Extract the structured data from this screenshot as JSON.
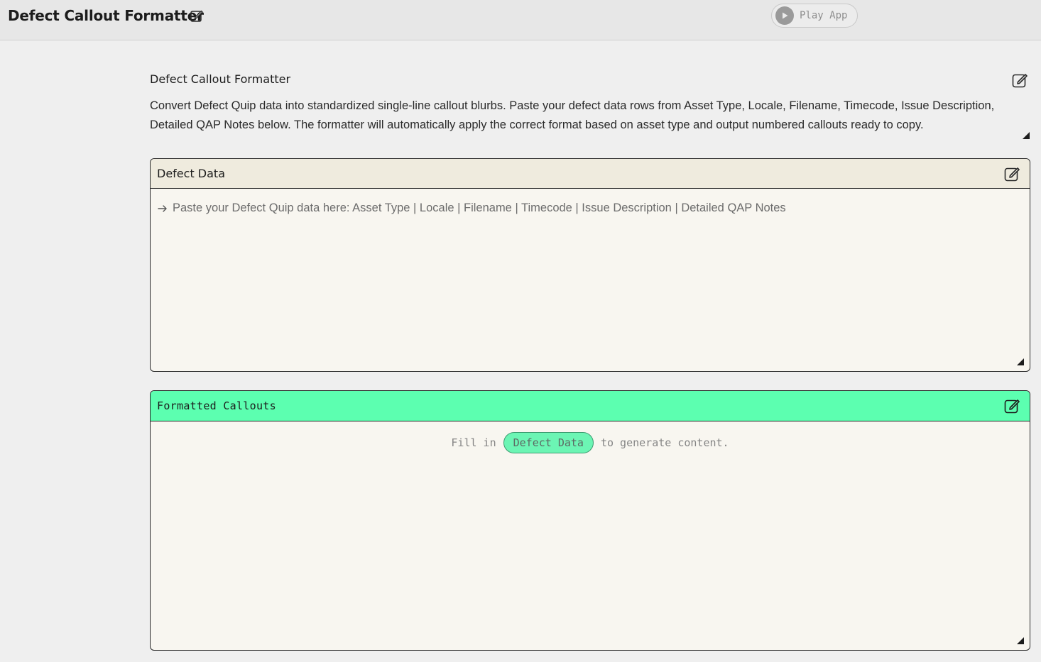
{
  "header": {
    "title": "Defect Callout Formatter",
    "play_label": "Play App"
  },
  "intro": {
    "title": "Defect Callout Formatter",
    "description": "Convert Defect Quip data into standardized single-line callout blurbs. Paste your defect data rows from Asset Type, Locale, Filename, Timecode, Issue Description, Detailed QAP Notes below. The formatter will automatically apply the correct format based on asset type and output numbered callouts ready to copy."
  },
  "defect_panel": {
    "label": "Defect Data",
    "placeholder": "Paste your Defect Quip data here: Asset Type | Locale | Filename | Timecode | Issue Description | Detailed QAP Notes"
  },
  "callout_panel": {
    "label": "Formatted Callouts",
    "prompt_prefix": "Fill in",
    "prompt_chip": "Defect Data",
    "prompt_suffix": "to generate content."
  },
  "icons": {
    "edit": "edit-square-icon",
    "play": "play-icon",
    "arrow": "arrow-right-icon",
    "resize": "resize-handle-icon"
  },
  "colors": {
    "accent_green": "#5cffb0",
    "panel_head_beige": "#efebde",
    "panel_body": "#f8f6f0",
    "page_bg": "#efefef"
  }
}
